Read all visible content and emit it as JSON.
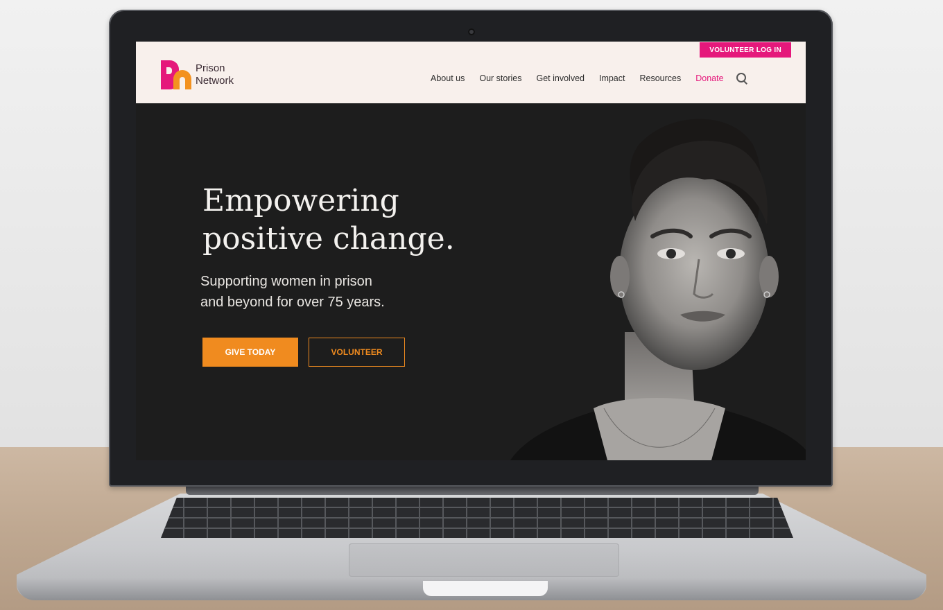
{
  "site": {
    "logo_line1": "Prison",
    "logo_line2": "Network",
    "volunteer_login": "VOLUNTEER LOG IN"
  },
  "nav": {
    "items": [
      "About us",
      "Our stories",
      "Get involved",
      "Impact",
      "Resources"
    ],
    "donate": "Donate"
  },
  "hero": {
    "headline_line1": "Empowering",
    "headline_line2": "positive change.",
    "sub_line1": "Supporting women in prison",
    "sub_line2": "and beyond for over 75 years.",
    "cta_primary": "GIVE TODAY",
    "cta_secondary": "VOLUNTEER"
  },
  "colors": {
    "brand_pink": "#e5187b",
    "brand_orange": "#f08b1f",
    "header_bg": "#f8f0ec",
    "hero_bg": "#1d1d1d"
  },
  "icons": {
    "search": "search-icon",
    "camera": "webcam-dot"
  }
}
